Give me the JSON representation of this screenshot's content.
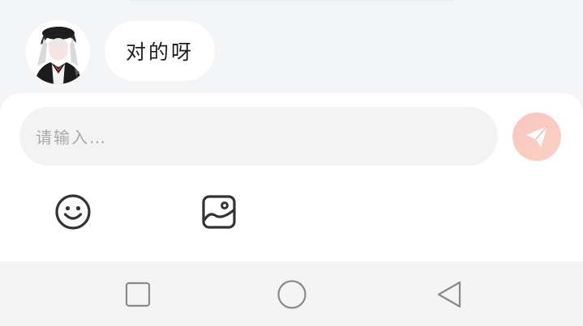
{
  "chat": {
    "message_text": "对的呀"
  },
  "composer": {
    "placeholder": "请输入…",
    "send_icon": "paper-plane-icon",
    "tools": [
      {
        "icon": "smiley-icon"
      },
      {
        "icon": "image-icon"
      }
    ]
  },
  "nav_bar": {
    "buttons": [
      {
        "icon": "square-icon"
      },
      {
        "icon": "circle-icon"
      },
      {
        "icon": "triangle-back-icon"
      }
    ]
  },
  "colors": {
    "background": "#f4f5f7",
    "bubble": "#ffffff",
    "input": "#f3f3f3",
    "send_accent": "#f7c1b8",
    "icon": "#333333",
    "nav_icon": "#8a8a8a"
  }
}
